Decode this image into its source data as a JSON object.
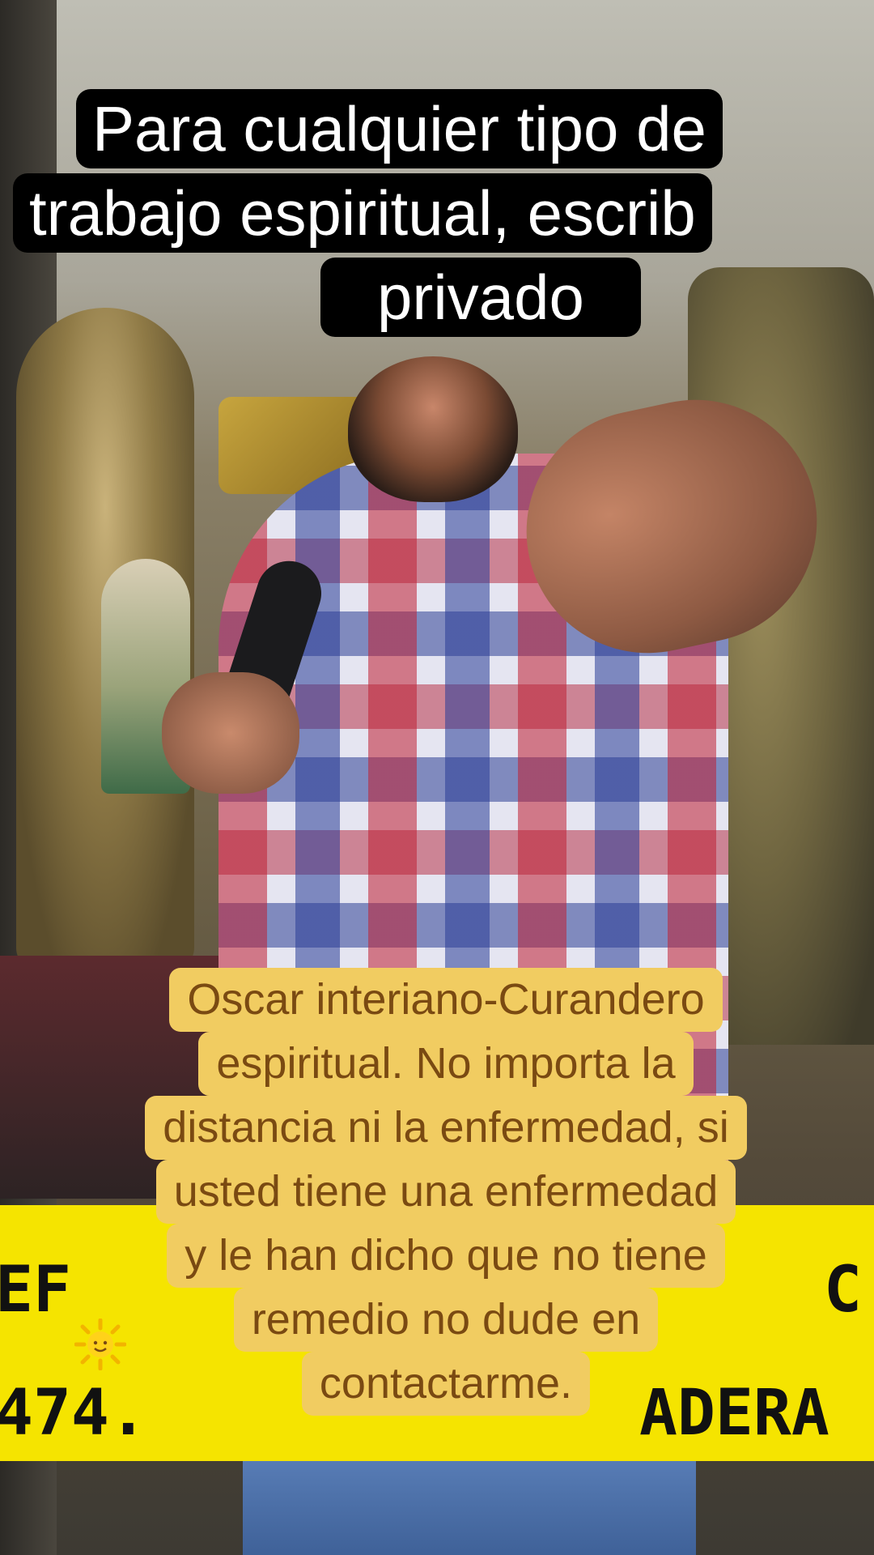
{
  "captions": {
    "top": {
      "line1": "Para cualquier tipo de",
      "line2": "trabajo espiritual, escrib",
      "line3": "privado"
    },
    "middle": {
      "line1": "Oscar interiano-Curandero",
      "line2": "espiritual. No importa la",
      "line3": "distancia ni la enfermedad, si",
      "line4": "usted tiene una enfermedad",
      "line5": "y le han dicho que no tiene",
      "line6": "remedio no dude en",
      "line7": "contactarme."
    }
  },
  "banner": {
    "left_top": "EF",
    "left_bottom": "474.",
    "right_top": "C",
    "right_bottom": "ADERA"
  },
  "icons": {
    "sun": "sun-emoji-icon"
  },
  "colors": {
    "top_caption_bg": "#000000",
    "top_caption_text": "#ffffff",
    "mid_caption_bg": "#f1cc61",
    "mid_caption_text": "#7a4a12",
    "banner": "#f5e400"
  }
}
